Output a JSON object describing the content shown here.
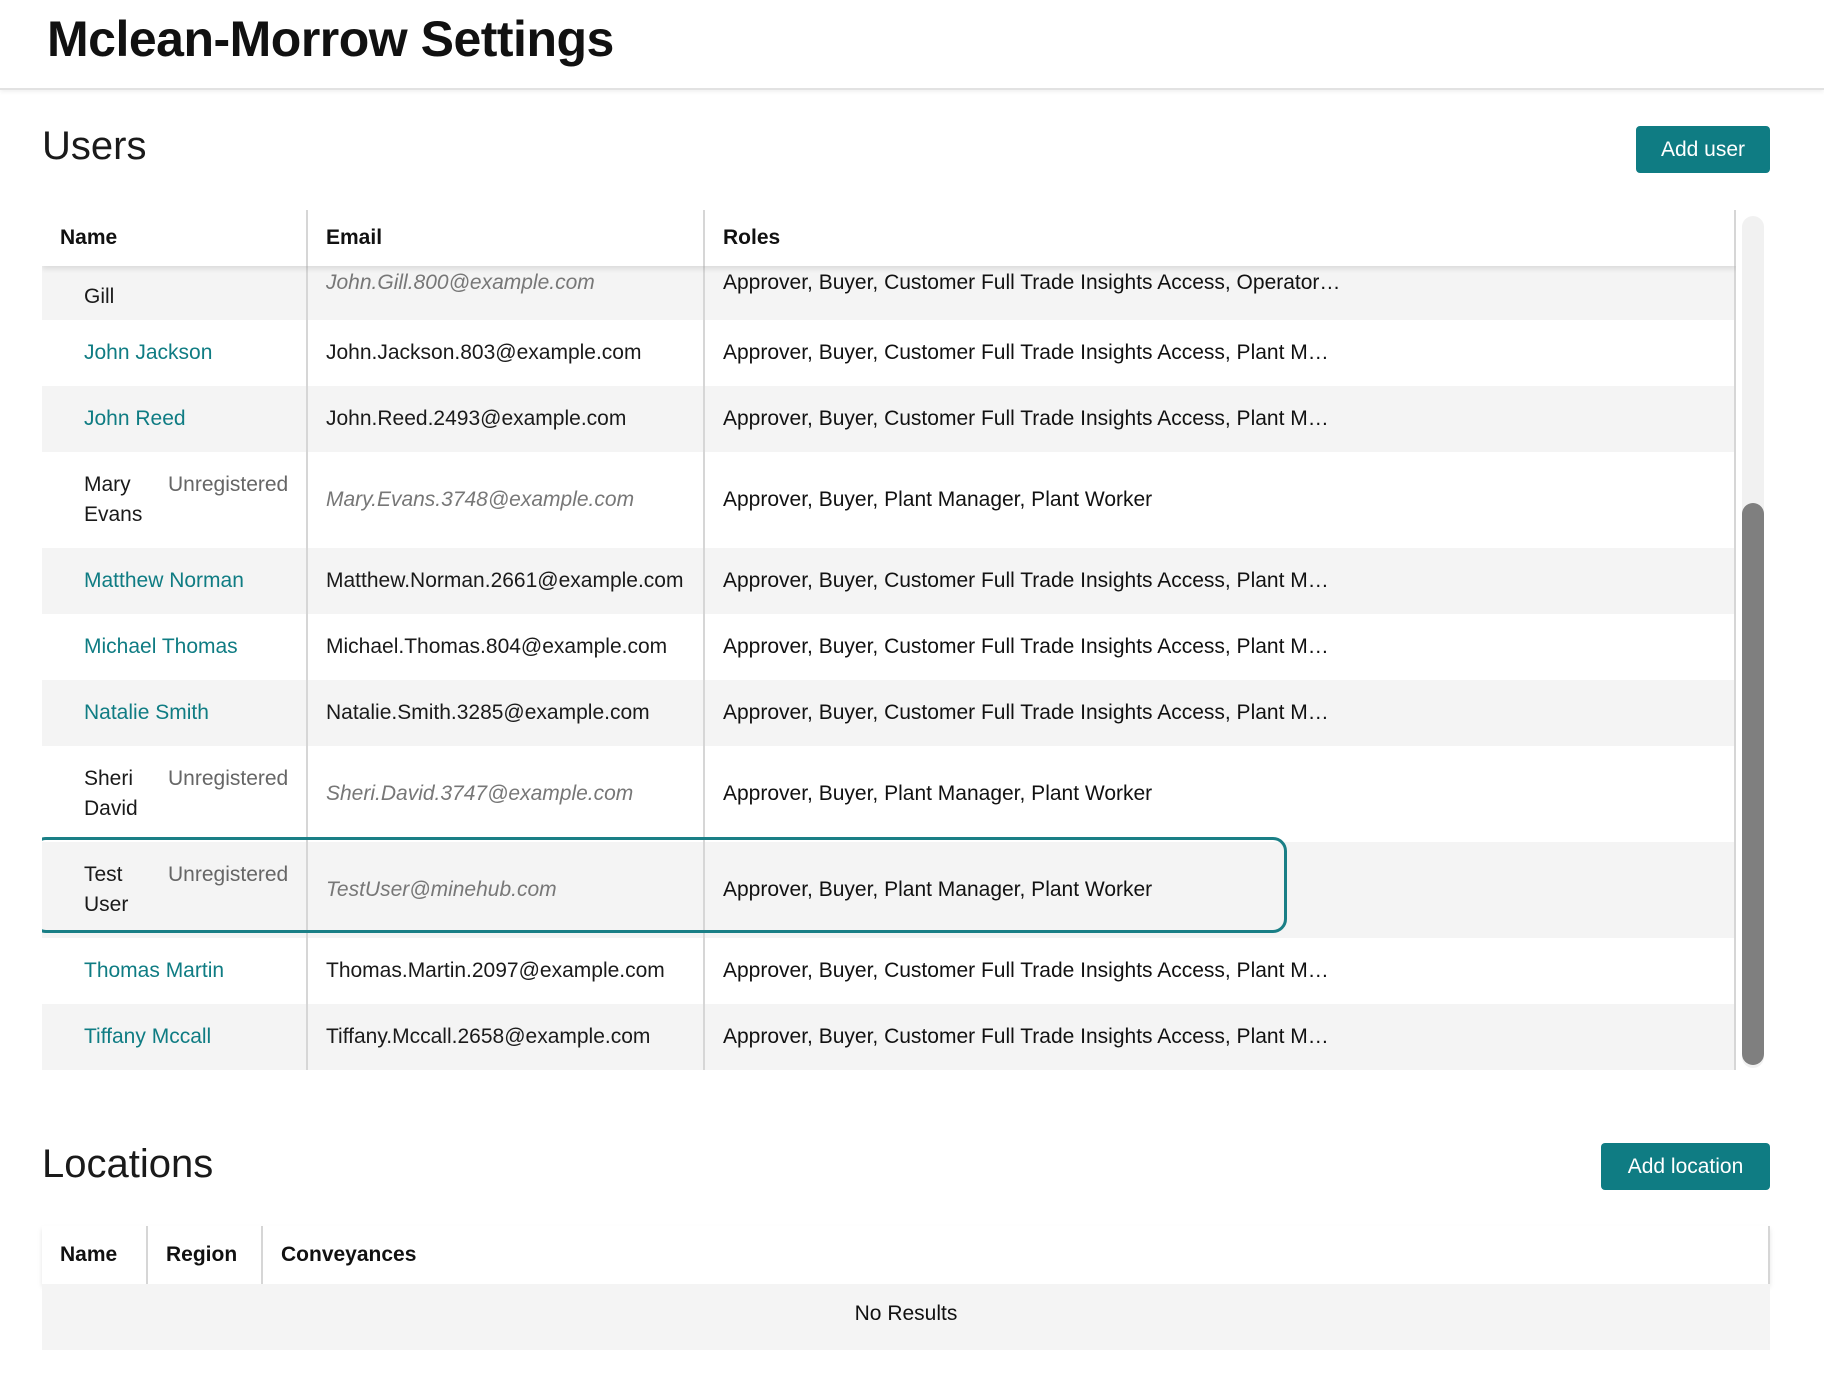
{
  "header": {
    "title": "Mclean-Morrow Settings"
  },
  "users": {
    "title": "Users",
    "add_button": "Add user",
    "columns": {
      "name": "Name",
      "email": "Email",
      "roles": "Roles"
    },
    "rows": [
      {
        "name": "Gill",
        "email": "John.Gill.800@example.com",
        "roles": "Approver, Buyer, Customer Full Trade Insights Access, Operator…"
      },
      {
        "name": "John Jackson",
        "email": "John.Jackson.803@example.com",
        "roles": "Approver, Buyer, Customer Full Trade Insights Access, Plant M…"
      },
      {
        "name": "John Reed",
        "email": "John.Reed.2493@example.com",
        "roles": "Approver, Buyer, Customer Full Trade Insights Access, Plant M…"
      },
      {
        "name_line1": "Mary",
        "name_line2": "Evans",
        "status": "Unregistered",
        "email": "Mary.Evans.3748@example.com",
        "roles": "Approver, Buyer, Plant Manager, Plant Worker"
      },
      {
        "name": "Matthew Norman",
        "email": "Matthew.Norman.2661@example.com",
        "roles": "Approver, Buyer, Customer Full Trade Insights Access, Plant M…"
      },
      {
        "name": "Michael Thomas",
        "email": "Michael.Thomas.804@example.com",
        "roles": "Approver, Buyer, Customer Full Trade Insights Access, Plant M…"
      },
      {
        "name": "Natalie Smith",
        "email": "Natalie.Smith.3285@example.com",
        "roles": "Approver, Buyer, Customer Full Trade Insights Access, Plant M…"
      },
      {
        "name_line1": "Sheri",
        "name_line2": "David",
        "status": "Unregistered",
        "email": "Sheri.David.3747@example.com",
        "roles": "Approver, Buyer, Plant Manager, Plant Worker"
      },
      {
        "name_line1": "Test",
        "name_line2": "User",
        "status": "Unregistered",
        "email": "TestUser@minehub.com",
        "roles": "Approver, Buyer, Plant Manager, Plant Worker"
      },
      {
        "name": "Thomas Martin",
        "email": "Thomas.Martin.2097@example.com",
        "roles": "Approver, Buyer, Customer Full Trade Insights Access, Plant M…"
      },
      {
        "name": "Tiffany Mccall",
        "email": "Tiffany.Mccall.2658@example.com",
        "roles": "Approver, Buyer, Customer Full Trade Insights Access, Plant M…"
      }
    ]
  },
  "locations": {
    "title": "Locations",
    "add_button": "Add location",
    "columns": {
      "name": "Name",
      "region": "Region",
      "conveyances": "Conveyances"
    },
    "empty_text": "No Results"
  },
  "colors": {
    "accent": "#0f7c83",
    "row_shade": "#f4f4f4"
  },
  "icons": []
}
